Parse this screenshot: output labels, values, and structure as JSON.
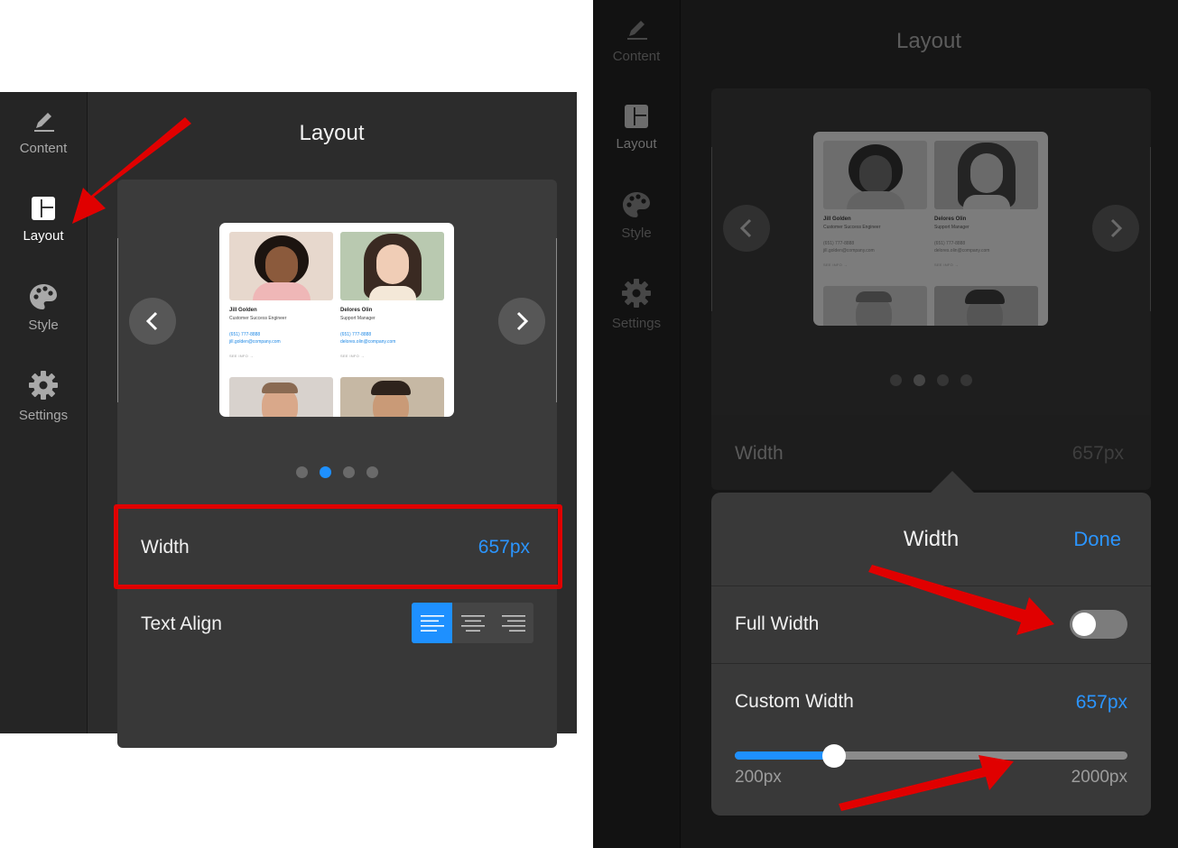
{
  "colors": {
    "accent": "#1e90ff",
    "value_blue": "#2b95ff",
    "annotation_red": "#e00000"
  },
  "left_panel": {
    "rail": [
      {
        "label": "Content",
        "icon": "pencil-icon"
      },
      {
        "label": "Layout",
        "icon": "layout-icon"
      },
      {
        "label": "Style",
        "icon": "palette-icon"
      },
      {
        "label": "Settings",
        "icon": "gear-icon"
      }
    ],
    "title": "Layout",
    "preview": {
      "people": [
        {
          "name": "Jill Golden",
          "role": "Customer Success Engineer",
          "phone": "(651) 777-8888",
          "email": "jill.golden@company.com",
          "more": "SEE INFO →"
        },
        {
          "name": "Delores Olin",
          "role": "Support Manager",
          "phone": "(651) 777-8888",
          "email": "delores.olin@company.com",
          "more": "SEE INFO →"
        }
      ],
      "page_count": 4,
      "active_page": 2
    },
    "width_row": {
      "label": "Width",
      "value": "657px"
    },
    "text_align_row": {
      "label": "Text Align",
      "selected": "left",
      "options": [
        "left",
        "center",
        "right"
      ]
    }
  },
  "right_panel": {
    "rail": [
      {
        "label": "Content",
        "icon": "pencil-icon"
      },
      {
        "label": "Layout",
        "icon": "layout-icon"
      },
      {
        "label": "Style",
        "icon": "palette-icon"
      },
      {
        "label": "Settings",
        "icon": "gear-icon"
      }
    ],
    "title": "Layout",
    "preview": {
      "people": [
        {
          "name": "Jill Golden",
          "role": "Customer Success Engineer",
          "phone": "(651) 777-8888",
          "email": "jill.golden@company.com",
          "more": "SEE INFO →"
        },
        {
          "name": "Delores Olin",
          "role": "Support Manager",
          "phone": "(651) 777-8888",
          "email": "delores.olin@company.com",
          "more": "SEE INFO →"
        }
      ],
      "page_count": 4,
      "active_page": 2
    },
    "width_row": {
      "label": "Width",
      "value": "657px"
    },
    "popover": {
      "title": "Width",
      "done_label": "Done",
      "full_width_label": "Full Width",
      "full_width_on": false,
      "custom_width_label": "Custom Width",
      "custom_width_value": "657px",
      "slider": {
        "min": 200,
        "max": 2000,
        "value": 657,
        "min_label": "200px",
        "max_label": "2000px"
      }
    }
  }
}
